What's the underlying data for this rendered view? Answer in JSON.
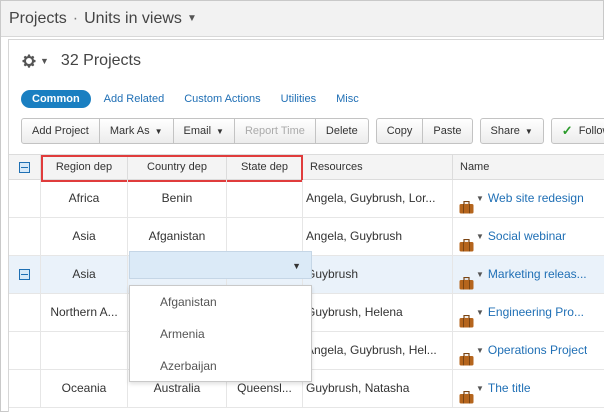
{
  "titlebar": {
    "project": "Projects",
    "separator": "·",
    "view": "Units in views"
  },
  "header": {
    "count_label": "32 Projects"
  },
  "subtabs": [
    {
      "label": "Common",
      "active": true
    },
    {
      "label": "Add Related"
    },
    {
      "label": "Custom Actions"
    },
    {
      "label": "Utilities"
    },
    {
      "label": "Misc"
    }
  ],
  "toolbar": {
    "add_project": "Add Project",
    "mark_as": "Mark As",
    "email": "Email",
    "report_time": "Report Time",
    "delete": "Delete",
    "copy": "Copy",
    "paste": "Paste",
    "share": "Share",
    "follow": "Follow"
  },
  "columns": {
    "region": "Region dep",
    "country": "Country dep",
    "state": "State dep",
    "resources": "Resources",
    "name": "Name"
  },
  "rows": [
    {
      "region": "Africa",
      "country": "Benin",
      "state": "",
      "resources": "Angela, Guybrush, Lor...",
      "name": "Web site redesign"
    },
    {
      "region": "Asia",
      "country": "Afganistan",
      "state": "",
      "resources": "Angela, Guybrush",
      "name": "Social webinar"
    },
    {
      "region": "Asia",
      "country": "",
      "state": "",
      "resources": "Guybrush",
      "name": "Marketing releas..."
    },
    {
      "region": "Northern A...",
      "country": "",
      "state": "",
      "resources": "Guybrush, Helena",
      "name": "Engineering Pro..."
    },
    {
      "region": "",
      "country": "",
      "state": "",
      "resources": "Angela, Guybrush, Hel...",
      "name": "Operations Project"
    },
    {
      "region": "Oceania",
      "country": "Australia",
      "state": "Queensl...",
      "resources": "Guybrush, Natasha",
      "name": "The title"
    }
  ],
  "dropdown_options": [
    "Afganistan",
    "Armenia",
    "Azerbaijan"
  ],
  "colors": {
    "accent": "#1a7fc1",
    "link": "#1f6fb5",
    "highlight_frame": "#e03c3c",
    "selected_row": "#eaf2fa",
    "bag_icon": "#b5651d"
  }
}
